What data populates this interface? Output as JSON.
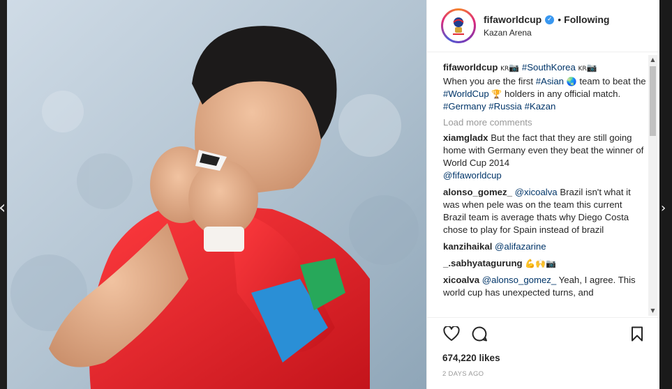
{
  "header": {
    "username": "fifaworldcup",
    "verified": true,
    "separator": "•",
    "follow_status": "Following",
    "location": "Kazan Arena"
  },
  "caption": {
    "user": "fifaworldcup",
    "flag1": "KR",
    "hashtag1": "#SouthKorea",
    "flag2": "KR",
    "text1": "When you are the first",
    "hashtag2": "#Asian",
    "text2": "team to beat the",
    "hashtag3": "#WorldCup",
    "text3": "holders in any official match.",
    "hashtag4": "#Germany",
    "hashtag5": "#Russia",
    "hashtag6": "#Kazan"
  },
  "load_more": "Load more comments",
  "comments": [
    {
      "user": "xiamgladx",
      "text": "But the fact that they are still going home with Germany even they beat the winner of World Cup 2014",
      "mention": "@fifaworldcup"
    },
    {
      "user": "alonso_gomez_",
      "mention": "@xicoalva",
      "text": "Brazil isn't what it was when pele was on the team this current Brazil team is average thats why Diego Costa chose to play for Spain instead of brazil"
    },
    {
      "user": "kanzihaikal",
      "mention": "@alifazarine",
      "text": ""
    },
    {
      "user": "_.sabhyatagurung",
      "mention": "",
      "text": ""
    },
    {
      "user": "xicoalva",
      "mention": "@alonso_gomez_",
      "text": "Yeah, I agree. This world cup has unexpected turns, and"
    }
  ],
  "likes": "674,220 likes",
  "time_ago": "2 DAYS AGO",
  "icons": {
    "like": "heart-icon",
    "comment": "comment-bubble-icon",
    "save": "bookmark-icon",
    "verified": "verified-badge-icon"
  },
  "colors": {
    "link": "#003569",
    "verified": "#3897f0",
    "jersey": "#e8262c",
    "armband": "#2a8fd6"
  }
}
